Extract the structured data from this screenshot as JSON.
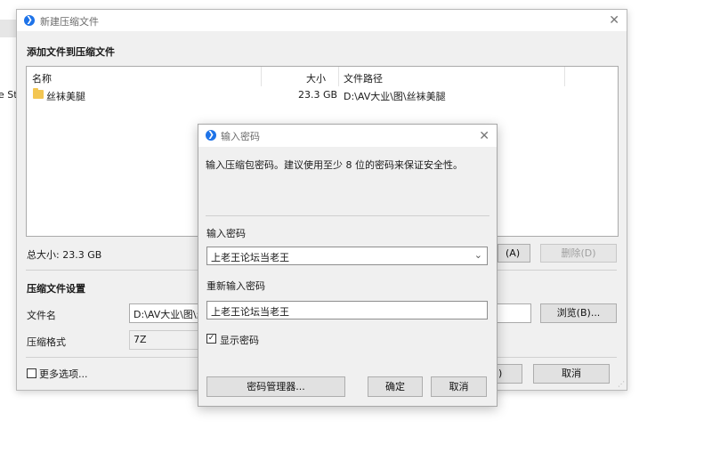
{
  "background": {
    "partial_text": "e St"
  },
  "main_window": {
    "title": "新建压缩文件",
    "section_add": "添加文件到压缩文件",
    "columns": {
      "name": "名称",
      "size": "大小",
      "path": "文件路径"
    },
    "files": [
      {
        "name": "丝袜美腿",
        "size": "23.3 GB",
        "path": "D:\\AV大业\\图\\丝袜美腿"
      }
    ],
    "total_size": "总大小: 23.3 GB",
    "add_button_partial": "(A)",
    "delete_button": "删除(D)",
    "section_settings": "压缩文件设置",
    "filename_label": "文件名",
    "filename_value": "D:\\AV大业\\图\\丝袜",
    "browse_button": "浏览(B)...",
    "format_label": "压缩格式",
    "format_value": "7Z",
    "more_options": "更多选项...",
    "ok_button_partial": ")",
    "cancel_button": "取消"
  },
  "password_dialog": {
    "title": "输入密码",
    "hint": "输入压缩包密码。建议使用至少 8 位的密码来保证安全性。",
    "password_label": "输入密码",
    "password_value": "上老王论坛当老王",
    "repeat_label": "重新输入密码",
    "repeat_value": "上老王论坛当老王",
    "show_password_label": "显示密码",
    "show_password_checked": true,
    "manager_button": "密码管理器...",
    "ok_button": "确定",
    "cancel_button": "取消"
  },
  "colors": {
    "accent": "#1e73e8",
    "dialog_bg": "#f0f0f0",
    "folder": "#f3c652"
  }
}
